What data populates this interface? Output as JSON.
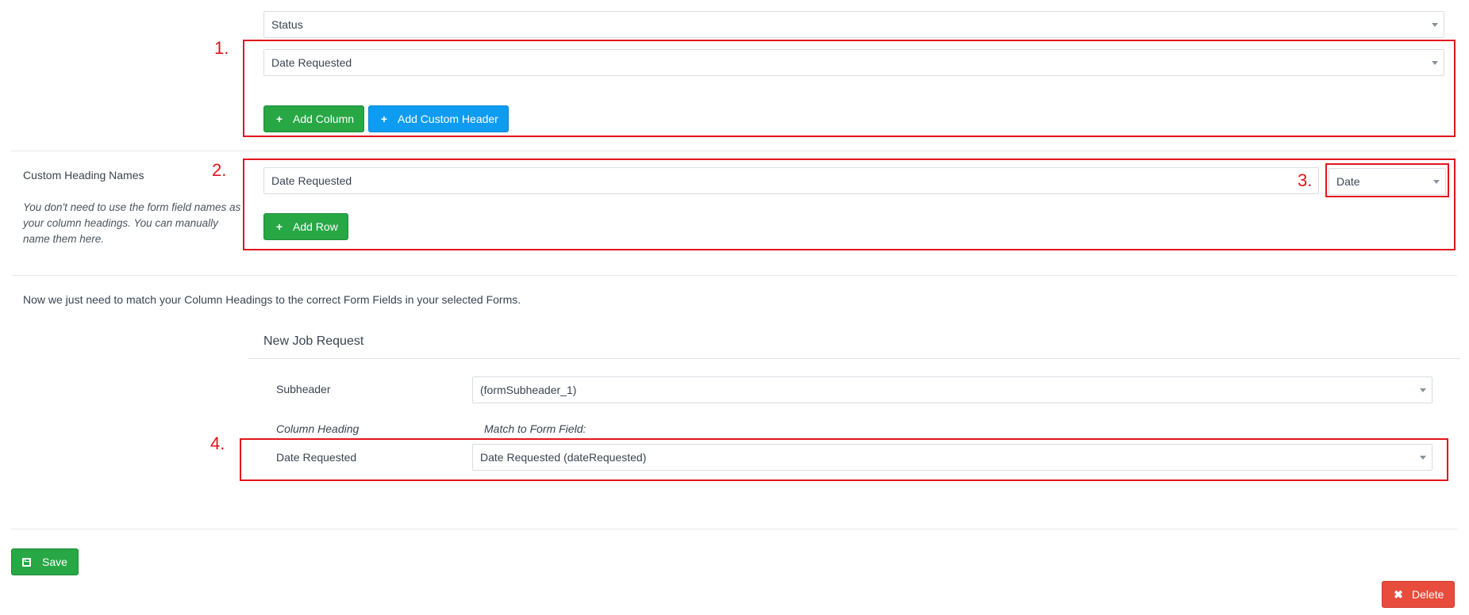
{
  "columns": {
    "status_select": "Status",
    "date_requested_select": "Date Requested",
    "add_column_label": "Add Column",
    "add_custom_header_label": "Add Custom Header"
  },
  "custom_headings": {
    "title": "Custom Heading Names",
    "hint": "You don't need to use the form field names as your column headings. You can manually name them here.",
    "row_input": "Date Requested",
    "type_select": "Date",
    "add_row_label": "Add Row"
  },
  "match_intro": "Now we just need to match your Column Headings to the correct Form Fields in your selected Forms.",
  "form": {
    "name": "New Job Request",
    "subheader_label": "Subheader",
    "subheader_value": "(formSubheader_1)",
    "col_heading_label": "Column Heading",
    "match_label": "Match to Form Field:",
    "row_label": "Date Requested",
    "row_value": "Date Requested (dateRequested)"
  },
  "actions": {
    "save_label": "Save",
    "delete_label": "Delete"
  },
  "annotations": {
    "m1": "1.",
    "m2": "2.",
    "m3": "3.",
    "m4": "4."
  },
  "colors": {
    "green": "#28a745",
    "blue": "#0d9cf2",
    "red": "#e74c3c",
    "annotation_red": "#e4141c"
  },
  "icons": {
    "plus": "plus-icon",
    "save": "floppy-disk-icon",
    "delete": "close-icon"
  }
}
